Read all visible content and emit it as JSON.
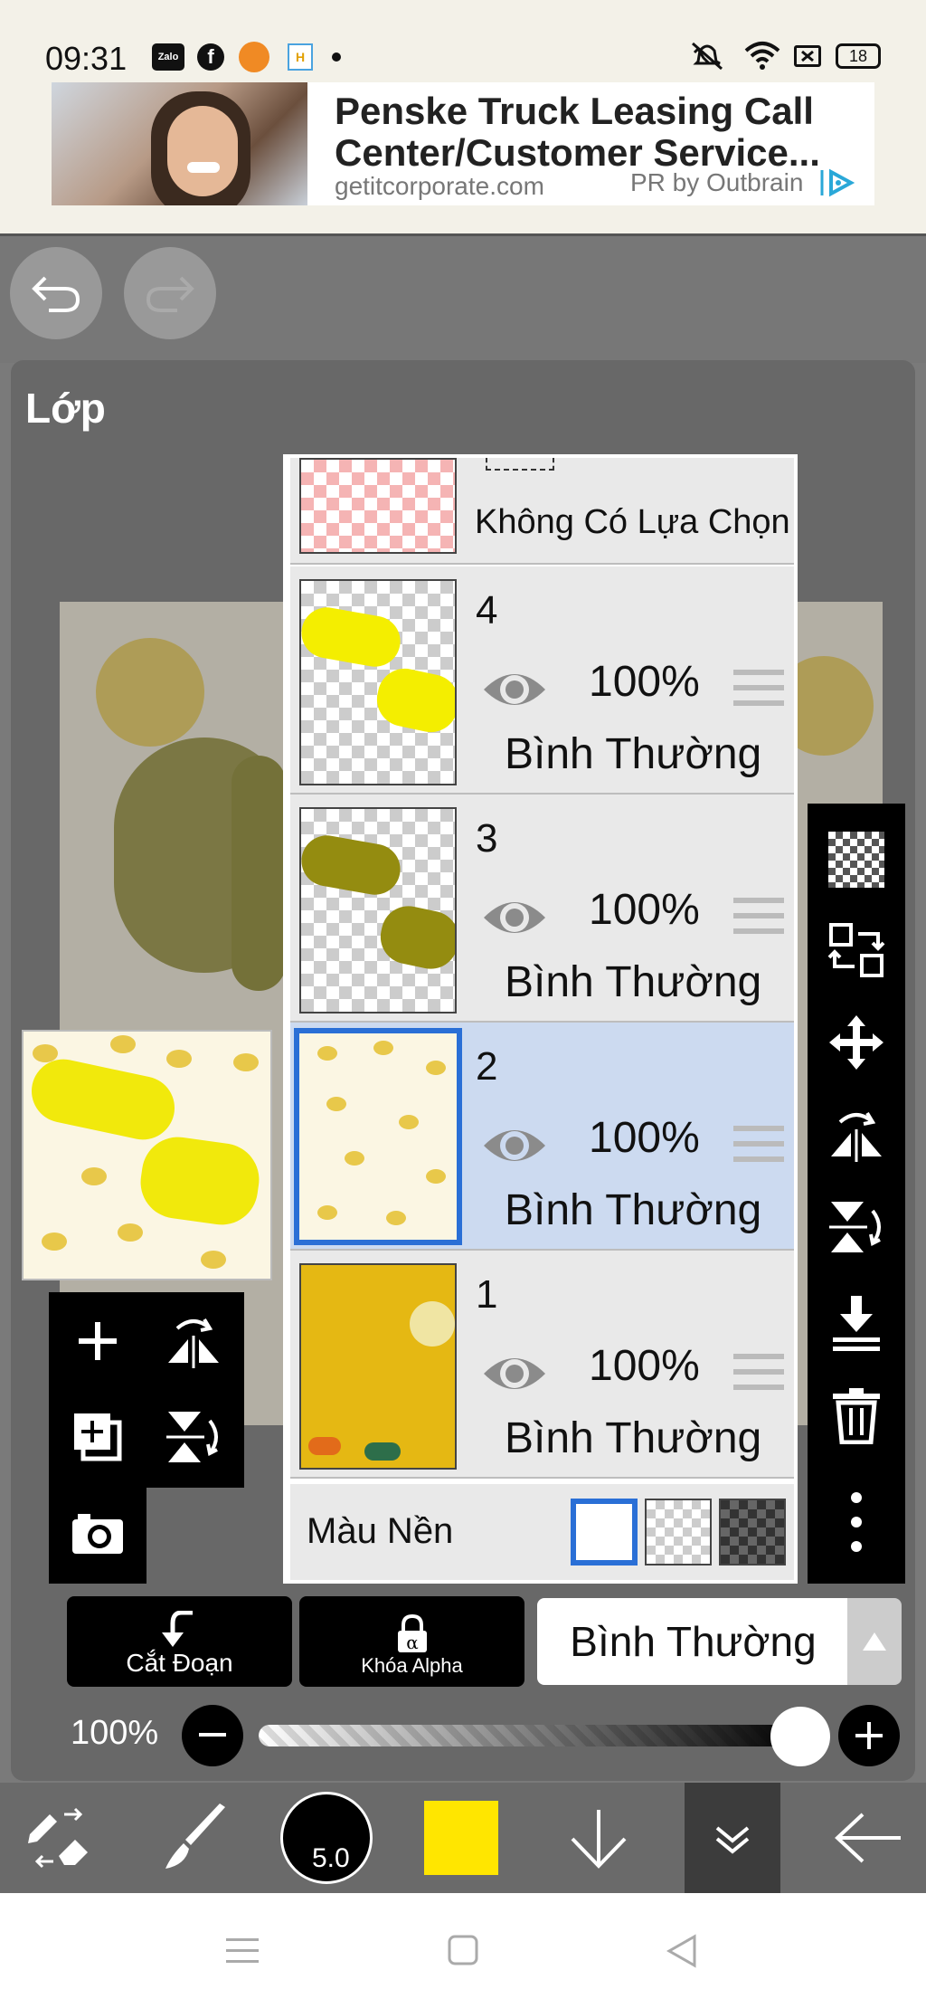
{
  "status_bar": {
    "time": "09:31",
    "notification_icons": [
      "zalo-icon",
      "facebook-icon",
      "app-orange-icon",
      "app-h-icon",
      "dot-icon"
    ],
    "zalo_text": "Zalo",
    "h_text": "H",
    "system_icons": [
      "mute-icon",
      "wifi-icon",
      "screen-icon",
      "battery-icon"
    ],
    "battery": "18"
  },
  "ad": {
    "title": "Penske Truck Leasing Call Center/Customer Service...",
    "domain": "getitcorporate.com",
    "credit": "PR by Outbrain"
  },
  "panel": {
    "title": "Lớp"
  },
  "layers": {
    "selection_layer": {
      "label": "Không Có Lựa Chọn"
    },
    "items": [
      {
        "name": "4",
        "opacity": "100%",
        "blend": "Bình Thường",
        "selected": false
      },
      {
        "name": "3",
        "opacity": "100%",
        "blend": "Bình Thường",
        "selected": false
      },
      {
        "name": "2",
        "opacity": "100%",
        "blend": "Bình Thường",
        "selected": true
      },
      {
        "name": "1",
        "opacity": "100%",
        "blend": "Bình Thường",
        "selected": false
      }
    ],
    "background_color_label": "Màu Nền"
  },
  "controls": {
    "clip_label": "Cắt Đoạn",
    "alpha_lock_label": "Khóa Alpha",
    "blend_mode": "Bình Thường",
    "opacity_label": "100%",
    "opacity_value": 1.0
  },
  "toolbar": {
    "brush_size": "5.0",
    "color": "#ffe600"
  },
  "colors": {
    "selected_row": "#ccdaf0",
    "selection_border": "#2a6fd6",
    "layer1_fill": "#e5b813"
  }
}
